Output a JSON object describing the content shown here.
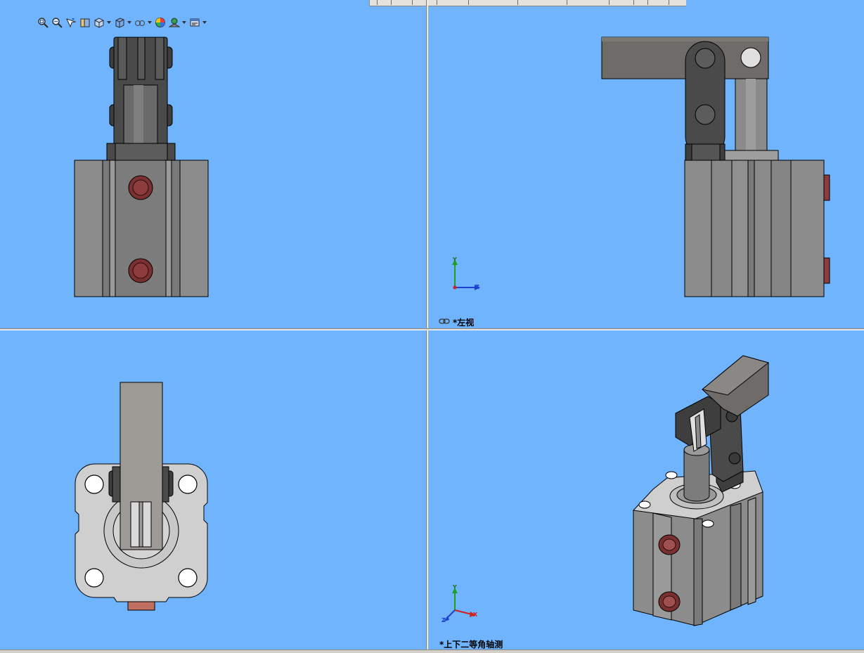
{
  "toolbar": {
    "items": [
      {
        "icon": "zoom-to-fit-icon"
      },
      {
        "icon": "zoom-to-area-icon"
      },
      {
        "icon": "previous-view-icon"
      },
      {
        "icon": "section-view-icon"
      },
      {
        "icon": "view-orientation-icon",
        "dropdown": true
      },
      {
        "icon": "display-style-icon",
        "dropdown": true
      },
      {
        "icon": "hide-show-items-icon",
        "dropdown": true
      },
      {
        "icon": "edit-appearance-icon"
      },
      {
        "icon": "apply-scene-icon",
        "dropdown": true
      },
      {
        "icon": "view-settings-icon",
        "dropdown": true
      }
    ]
  },
  "viewports": {
    "top_left": {
      "label": ""
    },
    "top_right": {
      "label": "*左视",
      "linked": true
    },
    "bottom_left": {
      "label": ""
    },
    "bottom_right": {
      "label": "*上下二等角轴测"
    }
  },
  "triad": {
    "x": "X",
    "y": "Y",
    "z": "Z"
  },
  "colors": {
    "background": "#6fb4fc",
    "body_gray": "#8a8a8a",
    "arm_gray": "#6e6b68",
    "link_dark": "#4a4a4a",
    "port_red": "#8c3c3c",
    "x_axis": "#d02020",
    "y_axis": "#20a020",
    "z_axis": "#2040d0"
  }
}
